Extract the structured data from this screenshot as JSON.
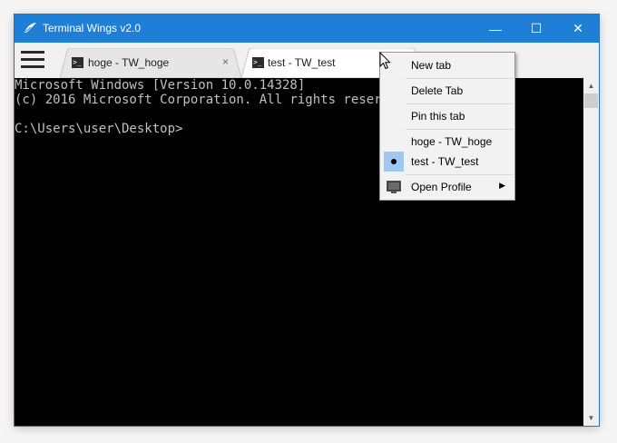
{
  "window": {
    "title": "Terminal Wings v2.0",
    "controls": {
      "minimize": "—",
      "maximize": "☐",
      "close": "✕"
    }
  },
  "tabs": [
    {
      "label": "hoge - TW_hoge",
      "close": "×",
      "icon": "terminal-icon",
      "active": false
    },
    {
      "label": "test - TW_test",
      "icon": "terminal-icon",
      "active": true
    }
  ],
  "terminal": {
    "lines": [
      "Microsoft Windows [Version 10.0.14328]",
      "(c) 2016 Microsoft Corporation. All rights reserved.",
      "",
      "C:\\Users\\user\\Desktop>"
    ]
  },
  "context_menu": {
    "items": {
      "new_tab": "New tab",
      "delete_tab": "Delete Tab",
      "pin_tab": "Pin this tab",
      "tab1": "hoge - TW_hoge",
      "tab2": "test - TW_test",
      "open_profile": "Open Profile"
    },
    "selected_tab": "test - TW_test",
    "submenu_arrow": "▶"
  },
  "scrollbar": {
    "up": "▲",
    "down": "▼"
  },
  "colors": {
    "titlebar": "#1f7fd6",
    "terminal_bg": "#000000",
    "terminal_fg": "#c0c0c0",
    "menu_check_highlight": "#9ec9ee"
  }
}
